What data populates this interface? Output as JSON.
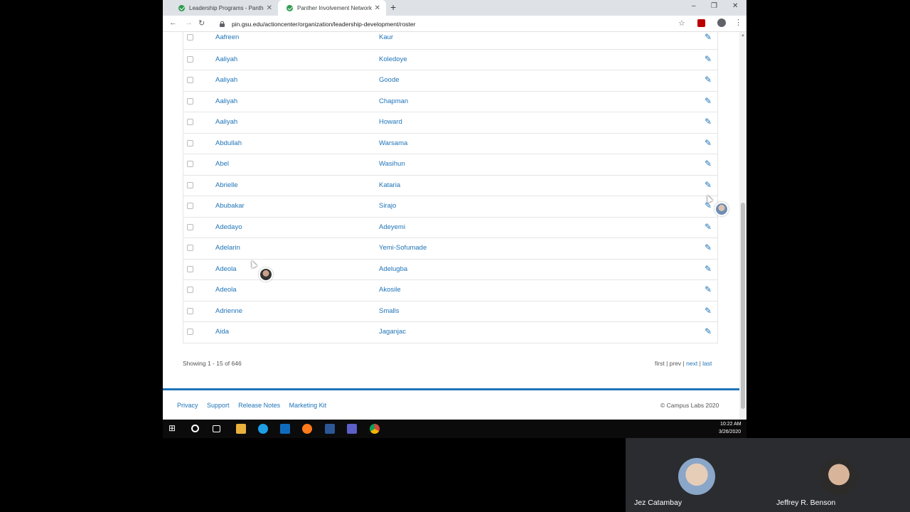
{
  "browser": {
    "tabs": [
      {
        "title": "Leadership Programs - Panther I",
        "active": false
      },
      {
        "title": "Panther Involvement Network (P",
        "active": true
      }
    ],
    "url": "pin.gsu.edu/actioncenter/organization/leadership-development/roster",
    "window_controls": {
      "minimize": "–",
      "restore": "❐",
      "close": "✕"
    },
    "new_tab": "+"
  },
  "roster": {
    "rows": [
      {
        "first": "Aafreen",
        "last": "Kaur"
      },
      {
        "first": "Aaliyah",
        "last": "Koledoye"
      },
      {
        "first": "Aaliyah",
        "last": "Goode"
      },
      {
        "first": "Aaliyah",
        "last": "Chapman"
      },
      {
        "first": "Aaliyah",
        "last": "Howard"
      },
      {
        "first": "Abdullah",
        "last": "Warsama"
      },
      {
        "first": "Abel",
        "last": "Wasihun"
      },
      {
        "first": "Abrielle",
        "last": "Kataria"
      },
      {
        "first": "Abubakar",
        "last": "Sirajo"
      },
      {
        "first": "Adedayo",
        "last": "Adeyemi"
      },
      {
        "first": "Adelarin",
        "last": "Yemi-Sofumade"
      },
      {
        "first": "Adeola",
        "last": "Adelugba"
      },
      {
        "first": "Adeola",
        "last": "Akosile"
      },
      {
        "first": "Adrienne",
        "last": "Smalls"
      },
      {
        "first": "Aida",
        "last": "Jaganjac"
      }
    ],
    "showing": "Showing 1 - 15 of 646",
    "pager": {
      "first": "first",
      "prev": "prev",
      "next": "next",
      "last": "last",
      "sep": " | "
    }
  },
  "footer": {
    "links": [
      "Privacy",
      "Support",
      "Release Notes",
      "Marketing Kit"
    ],
    "copyright": "© Campus Labs 2020"
  },
  "taskbar": {
    "time": "10:22 AM",
    "date": "3/26/2020",
    "icons": [
      "windows-start-icon",
      "cortana-icon",
      "task-view-icon",
      "file-explorer-icon",
      "skype-icon",
      "outlook-icon",
      "firefox-icon",
      "word-icon",
      "teams-icon",
      "chrome-icon"
    ]
  },
  "participants": [
    {
      "name": "Jez Catambay"
    },
    {
      "name": "Jeffrey R. Benson"
    }
  ],
  "colors": {
    "link": "#1f74b8",
    "footer_rule": "#1f74b8",
    "tile_bg": "#2b2c30"
  }
}
